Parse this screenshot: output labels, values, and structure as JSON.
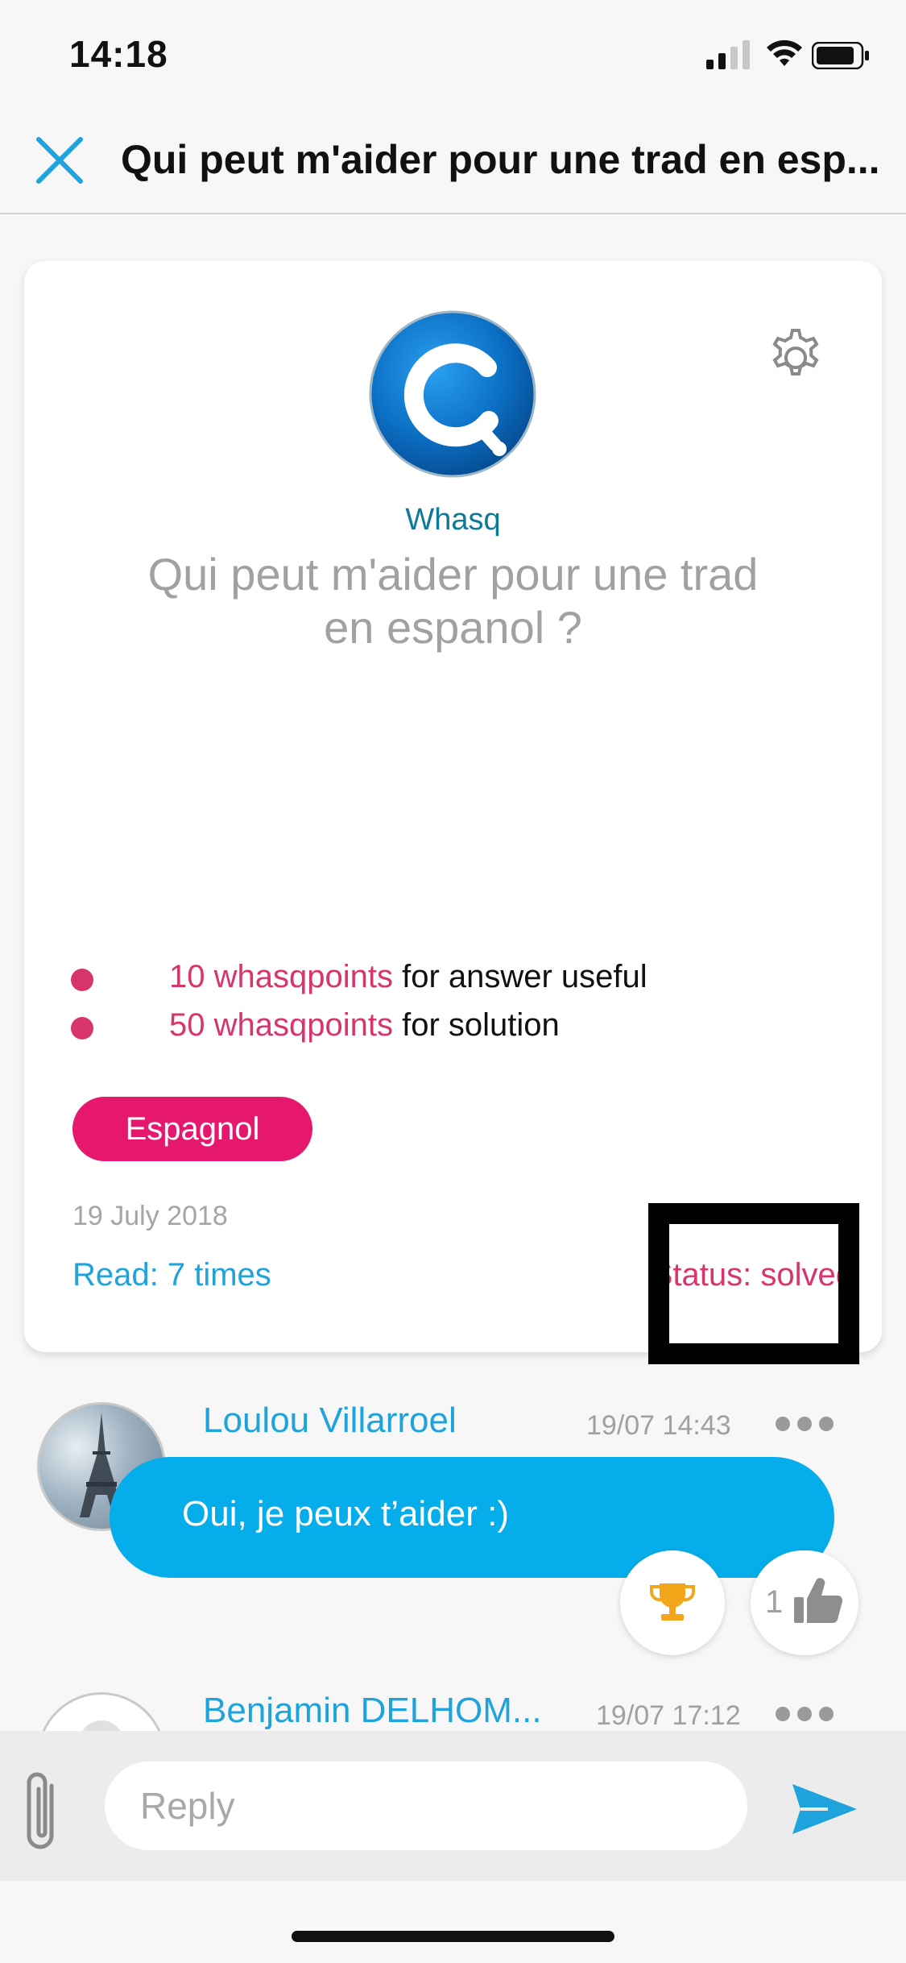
{
  "status_bar": {
    "time": "14:18"
  },
  "header": {
    "title": "Qui peut m'aider pour une trad en esp..."
  },
  "question_card": {
    "author": "Whasq",
    "question": "Qui peut m'aider pour une trad en espanol ?",
    "points": [
      {
        "amount": "10 whasqpoints",
        "text": " for answer useful"
      },
      {
        "amount": "50 whasqpoints",
        "text": " for solution"
      }
    ],
    "tag": "Espagnol",
    "date": "19 July 2018",
    "read": "Read: 7 times",
    "status": "Status: solved",
    "accent_color": "#e6186e",
    "link_color": "#1fa3dc"
  },
  "comments": [
    {
      "user": "Loulou Villarroel",
      "time": "19/07 14:43",
      "message": "Oui, je peux t’aider :)",
      "likes": "1",
      "bubble_color": "#05aeea"
    },
    {
      "user": "Benjamin DELHOM...",
      "time": "19/07 17:12"
    }
  ],
  "reply": {
    "placeholder": "Reply"
  }
}
